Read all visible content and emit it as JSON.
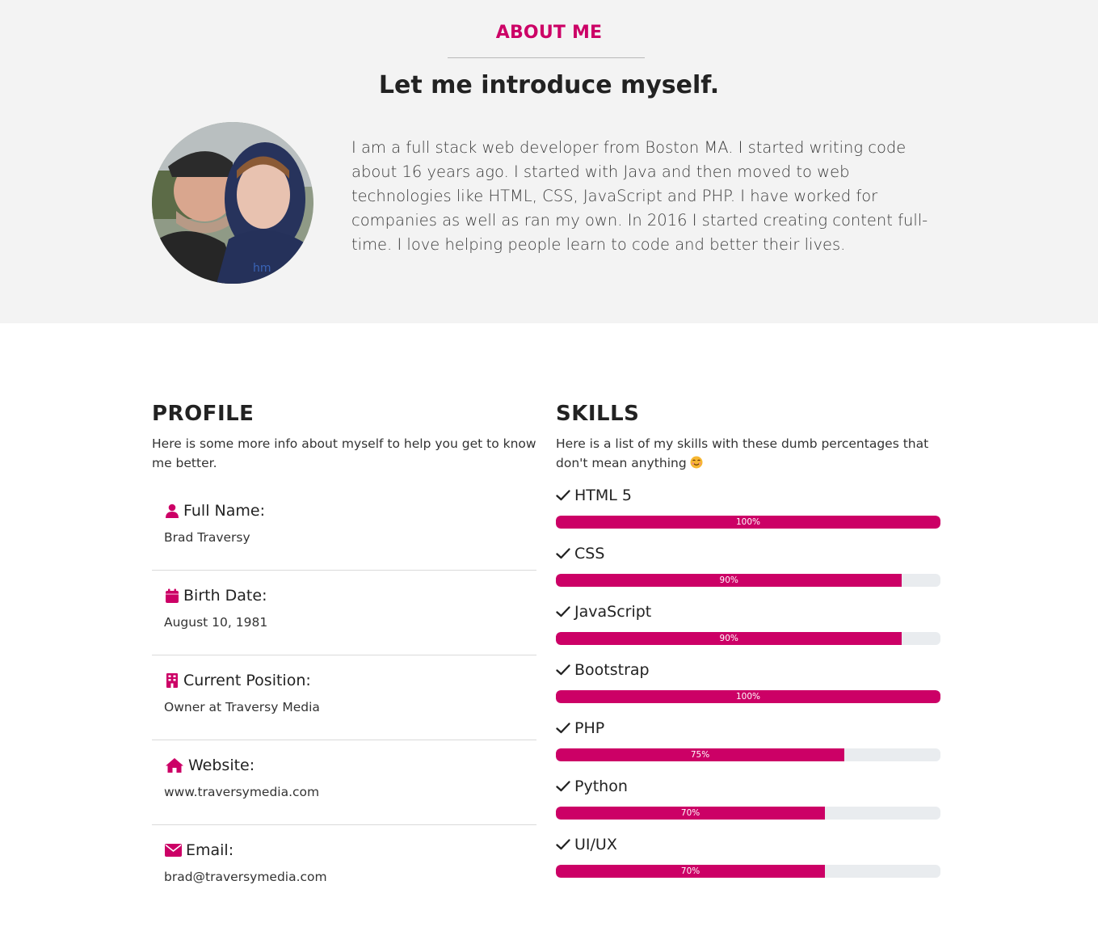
{
  "about": {
    "title": "ABOUT ME",
    "subtitle": "Let me introduce myself.",
    "bio": "I am a full stack web developer from Boston MA. I started writing code about 16 years ago. I started with Java and then moved to web technologies like HTML, CSS, JavaScript and PHP. I have worked for companies as well as ran my own. In 2016 I started creating content full-time. I love helping people learn to code and better their lives."
  },
  "profile": {
    "title": "PROFILE",
    "description": "Here is some more info about myself to help you get to know me better.",
    "items": [
      {
        "label": "Full Name:",
        "value": "Brad Traversy",
        "icon": "user-icon"
      },
      {
        "label": "Birth Date:",
        "value": "August 10, 1981",
        "icon": "calendar-icon"
      },
      {
        "label": "Current Position:",
        "value": "Owner at Traversy Media",
        "icon": "building-icon"
      },
      {
        "label": "Website:",
        "value": "www.traversymedia.com",
        "icon": "home-icon"
      },
      {
        "label": "Email:",
        "value": "brad@traversymedia.com",
        "icon": "envelope-icon"
      }
    ]
  },
  "skills": {
    "title": "SKILLS",
    "description": "Here is a list of my skills with these dumb percentages that don't mean anything",
    "items": [
      {
        "name": "HTML 5",
        "percent": 100,
        "label": "100%"
      },
      {
        "name": "CSS",
        "percent": 90,
        "label": "90%"
      },
      {
        "name": "JavaScript",
        "percent": 90,
        "label": "90%"
      },
      {
        "name": "Bootstrap",
        "percent": 100,
        "label": "100%"
      },
      {
        "name": "PHP",
        "percent": 75,
        "label": "75%"
      },
      {
        "name": "Python",
        "percent": 70,
        "label": "70%"
      },
      {
        "name": "UI/UX",
        "percent": 70,
        "label": "70%"
      }
    ]
  },
  "colors": {
    "accent": "#cc0066",
    "bar_track": "#e9ecef",
    "section_bg": "#f3f3f3"
  }
}
